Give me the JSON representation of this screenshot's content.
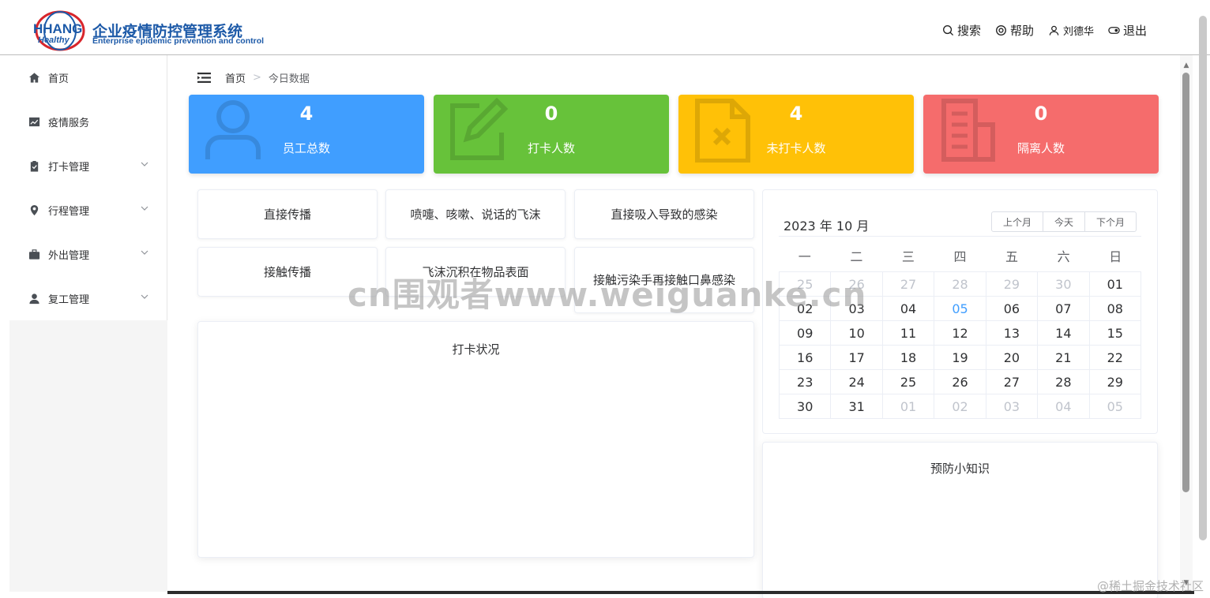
{
  "header": {
    "logo_word": "HHANG",
    "logo_sub": "Healthy",
    "title": "企业疫情防控管理系统",
    "subtitle": "Enterprise epidemic prevention and control",
    "search": "搜索",
    "help": "帮助",
    "user": "刘德华",
    "logout": "退出"
  },
  "sidebar": {
    "items": [
      {
        "label": "首页",
        "icon": "home-icon",
        "has_children": false
      },
      {
        "label": "疫情服务",
        "icon": "trend-chart-icon",
        "has_children": false
      },
      {
        "label": "打卡管理",
        "icon": "clipboard-icon",
        "has_children": true
      },
      {
        "label": "行程管理",
        "icon": "location-icon",
        "has_children": true
      },
      {
        "label": "外出管理",
        "icon": "briefcase-icon",
        "has_children": true
      },
      {
        "label": "复工管理",
        "icon": "user-icon",
        "has_children": true
      }
    ]
  },
  "breadcrumb": {
    "home": "首页",
    "current": "今日数据"
  },
  "stats": [
    {
      "value": "4",
      "label": "员工总数",
      "color": "#409eff",
      "icon": "user-outline-icon"
    },
    {
      "value": "0",
      "label": "打卡人数",
      "color": "#67c23a",
      "icon": "edit-icon"
    },
    {
      "value": "4",
      "label": "未打卡人数",
      "color": "#ffc107",
      "icon": "document-x-icon"
    },
    {
      "value": "0",
      "label": "隔离人数",
      "color": "#f56c6c",
      "icon": "building-icon"
    }
  ],
  "transmission": [
    "直接传播",
    "喷嚏、咳嗽、说话的飞沫",
    "直接吸入导致的感染",
    "接触传播",
    "飞沫沉积在物品表面",
    "接触污染手再接触口鼻感染"
  ],
  "checkin_panel": {
    "title": "打卡状况"
  },
  "tips_panel": {
    "title": "预防小知识"
  },
  "calendar": {
    "title": "2023 年 10 月",
    "prev": "上个月",
    "today": "今天",
    "next": "下个月",
    "weekdays": [
      "一",
      "二",
      "三",
      "四",
      "五",
      "六",
      "日"
    ],
    "days": [
      {
        "d": "25",
        "t": "other"
      },
      {
        "d": "26",
        "t": "other"
      },
      {
        "d": "27",
        "t": "other"
      },
      {
        "d": "28",
        "t": "other"
      },
      {
        "d": "29",
        "t": "other"
      },
      {
        "d": "30",
        "t": "other"
      },
      {
        "d": "01",
        "t": "cur"
      },
      {
        "d": "02",
        "t": "cur"
      },
      {
        "d": "03",
        "t": "cur"
      },
      {
        "d": "04",
        "t": "cur"
      },
      {
        "d": "05",
        "t": "today"
      },
      {
        "d": "06",
        "t": "cur"
      },
      {
        "d": "07",
        "t": "cur"
      },
      {
        "d": "08",
        "t": "cur"
      },
      {
        "d": "09",
        "t": "cur"
      },
      {
        "d": "10",
        "t": "cur"
      },
      {
        "d": "11",
        "t": "cur"
      },
      {
        "d": "12",
        "t": "cur"
      },
      {
        "d": "13",
        "t": "cur"
      },
      {
        "d": "14",
        "t": "cur"
      },
      {
        "d": "15",
        "t": "cur"
      },
      {
        "d": "16",
        "t": "cur"
      },
      {
        "d": "17",
        "t": "cur"
      },
      {
        "d": "18",
        "t": "cur"
      },
      {
        "d": "19",
        "t": "cur"
      },
      {
        "d": "20",
        "t": "cur"
      },
      {
        "d": "21",
        "t": "cur"
      },
      {
        "d": "22",
        "t": "cur"
      },
      {
        "d": "23",
        "t": "cur"
      },
      {
        "d": "24",
        "t": "cur"
      },
      {
        "d": "25",
        "t": "cur"
      },
      {
        "d": "26",
        "t": "cur"
      },
      {
        "d": "27",
        "t": "cur"
      },
      {
        "d": "28",
        "t": "cur"
      },
      {
        "d": "29",
        "t": "cur"
      },
      {
        "d": "30",
        "t": "cur"
      },
      {
        "d": "31",
        "t": "cur"
      },
      {
        "d": "01",
        "t": "other"
      },
      {
        "d": "02",
        "t": "other"
      },
      {
        "d": "03",
        "t": "other"
      },
      {
        "d": "04",
        "t": "other"
      },
      {
        "d": "05",
        "t": "other"
      }
    ]
  },
  "watermarks": {
    "overlay": "cn围观者www.weiguanke.cn",
    "corner": "@稀土掘金技术社区"
  }
}
